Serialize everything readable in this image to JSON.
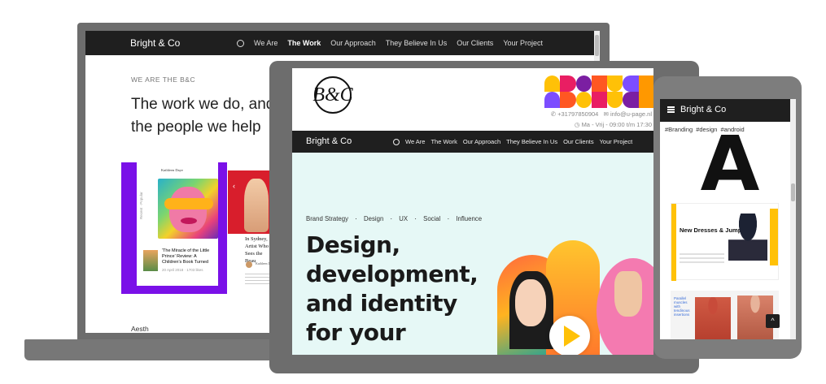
{
  "laptop": {
    "brand": "Bright & Co",
    "menu": [
      "We Are",
      "The Work",
      "Our Approach",
      "They Believe In Us",
      "Our Clients",
      "Your Project"
    ],
    "active_menu": "The Work",
    "eyebrow": "WE ARE THE B&C",
    "heading": "The work we do, and the people we help",
    "card_author": "Kathleen Daye",
    "card_side_a": "Popular",
    "card_side_b": "Recent",
    "card_title": "'The Miracle of the Little Prince' Review: A Children's Book Turned",
    "card_date": "20 April 2018 · 1703 likes",
    "card_red_title": "In Sydney, Artist Who Sees the Beau",
    "card_red_author": "Kathleen Daye",
    "card_red_prev": "‹",
    "footer_text": "Aesth"
  },
  "tablet": {
    "logo": "B&C",
    "phone": "+31797850904",
    "email": "info@u-page.nl",
    "hours": "Ma - Vrij - 09:00 t/m 17:30",
    "brand": "Bright & Co",
    "menu": [
      "We Are",
      "The Work",
      "Our Approach",
      "They Believe In Us",
      "Our Clients",
      "Your Project"
    ],
    "tags": [
      "Brand Strategy",
      "Design",
      "UX",
      "Social",
      "Influence"
    ],
    "hero_title": "Design, development, and identity for your",
    "pattern_colors": [
      "#ffc107",
      "#e91e63",
      "#7b1fa2",
      "#ff5722",
      "#ffc107",
      "#7c4dff",
      "#ff9800",
      "#7c4dff",
      "#ff5722",
      "#ffc107",
      "#e91e63",
      "#ffc107",
      "#7b1fa2",
      "#ff9800"
    ]
  },
  "phone": {
    "brand": "Bright & Co",
    "tags": [
      "#Branding",
      "#design",
      "#android"
    ],
    "hero_letter": "A",
    "shop_title": "New Dresses & Jumpsuits",
    "anatomy_title": "Parallel muscles with tendinous insertions",
    "back_to_top": "^"
  },
  "colors": {
    "device_frame": "#6d6d6d",
    "navbar": "#1f1f1f",
    "hero_bg": "#e6f8f6",
    "accent_purple": "#7a10e8",
    "accent_yellow": "#ffc107",
    "play_color": "#ffc107"
  },
  "icons": {
    "globe": "globe-icon",
    "phone": "phone-icon",
    "email": "mail-icon",
    "clock": "clock-icon",
    "menu": "hamburger-icon",
    "play": "play-icon",
    "back_to_top": "chevron-up-icon"
  }
}
